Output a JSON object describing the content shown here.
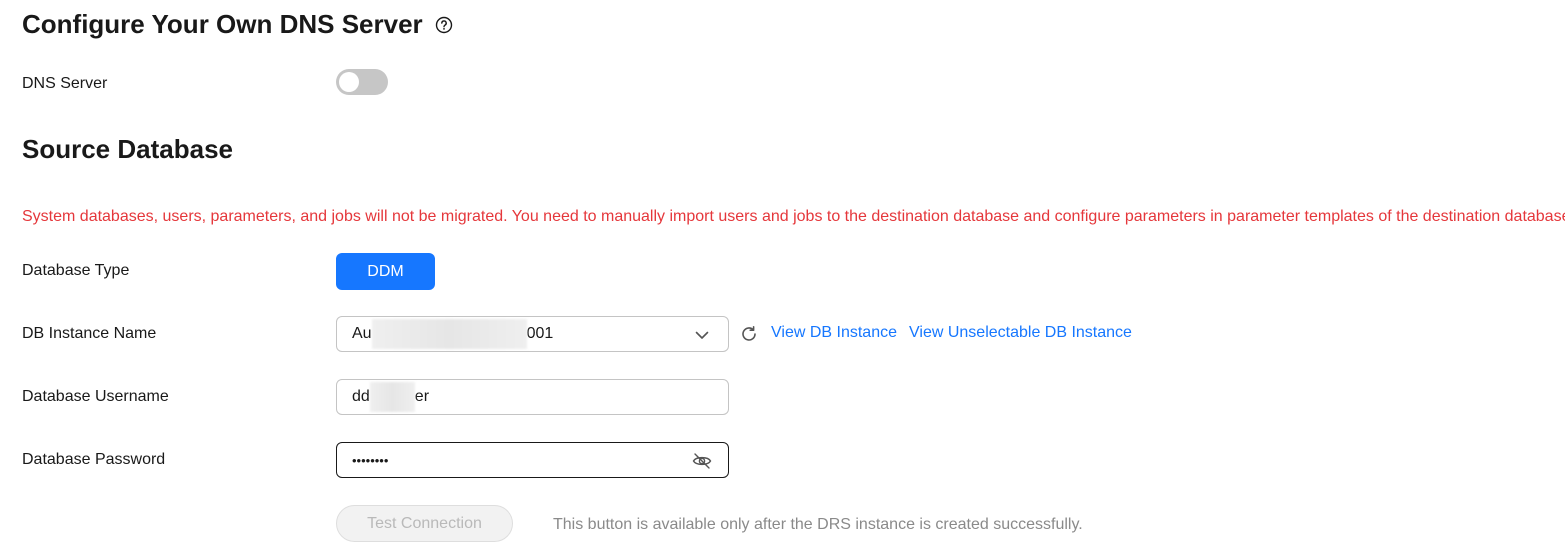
{
  "dns": {
    "title": "Configure Your Own DNS Server",
    "help_icon": "question-circle-icon",
    "server_label": "DNS Server",
    "server_enabled": false
  },
  "source": {
    "title": "Source Database",
    "warning": "System databases, users, parameters, and jobs will not be migrated. You need to manually import users and jobs to the destination database and configure parameters in parameter templates of the destination database.",
    "type_label": "Database Type",
    "type_value": "DDM",
    "instance_label": "DB Instance Name",
    "instance_value_prefix": "Au",
    "instance_value_suffix": "001",
    "refresh_icon": "refresh-icon",
    "view_instance_link": "View DB Instance",
    "view_unselectable_link": "View Unselectable DB Instance",
    "username_label": "Database Username",
    "username_prefix": "dd",
    "username_suffix": "er",
    "password_label": "Database Password",
    "password_mask": "••••••••",
    "eye_icon": "eye-off-icon",
    "test_button": "Test Connection",
    "test_hint": "This button is available only after the DRS instance is created successfully."
  },
  "colors": {
    "accent": "#1677ff",
    "warning": "#e5373b",
    "toggle_off": "#c6c6c6"
  }
}
